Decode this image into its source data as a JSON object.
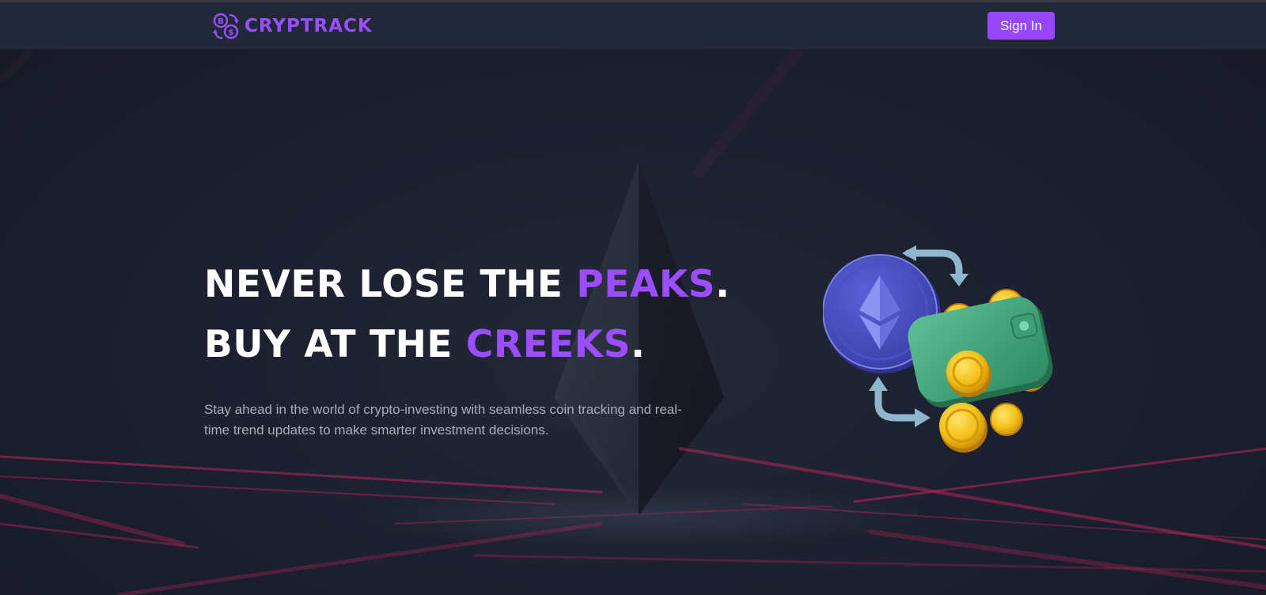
{
  "brand": {
    "name": "CRYPTRACK",
    "accent_color": "#9b4dff",
    "logo_icon": "bitcoin-dollar-exchange-icon"
  },
  "nav": {
    "signin_label": "Sign In",
    "button_color": "#9747ff"
  },
  "hero": {
    "line1_prefix": "NEVER LOSE THE ",
    "line1_accent": "PEAKS",
    "line1_suffix": ".",
    "line2_prefix": "BUY AT THE ",
    "line2_accent": "CREEKS",
    "line2_suffix": ".",
    "subtext": "Stay ahead in the world of crypto-investing with seamless coin tracking and real-time trend updates to make smarter investment decisions.",
    "illustration": "ethereum-coin-wallet-exchange-icon",
    "background_art": "ethereum-crystal-icon"
  }
}
